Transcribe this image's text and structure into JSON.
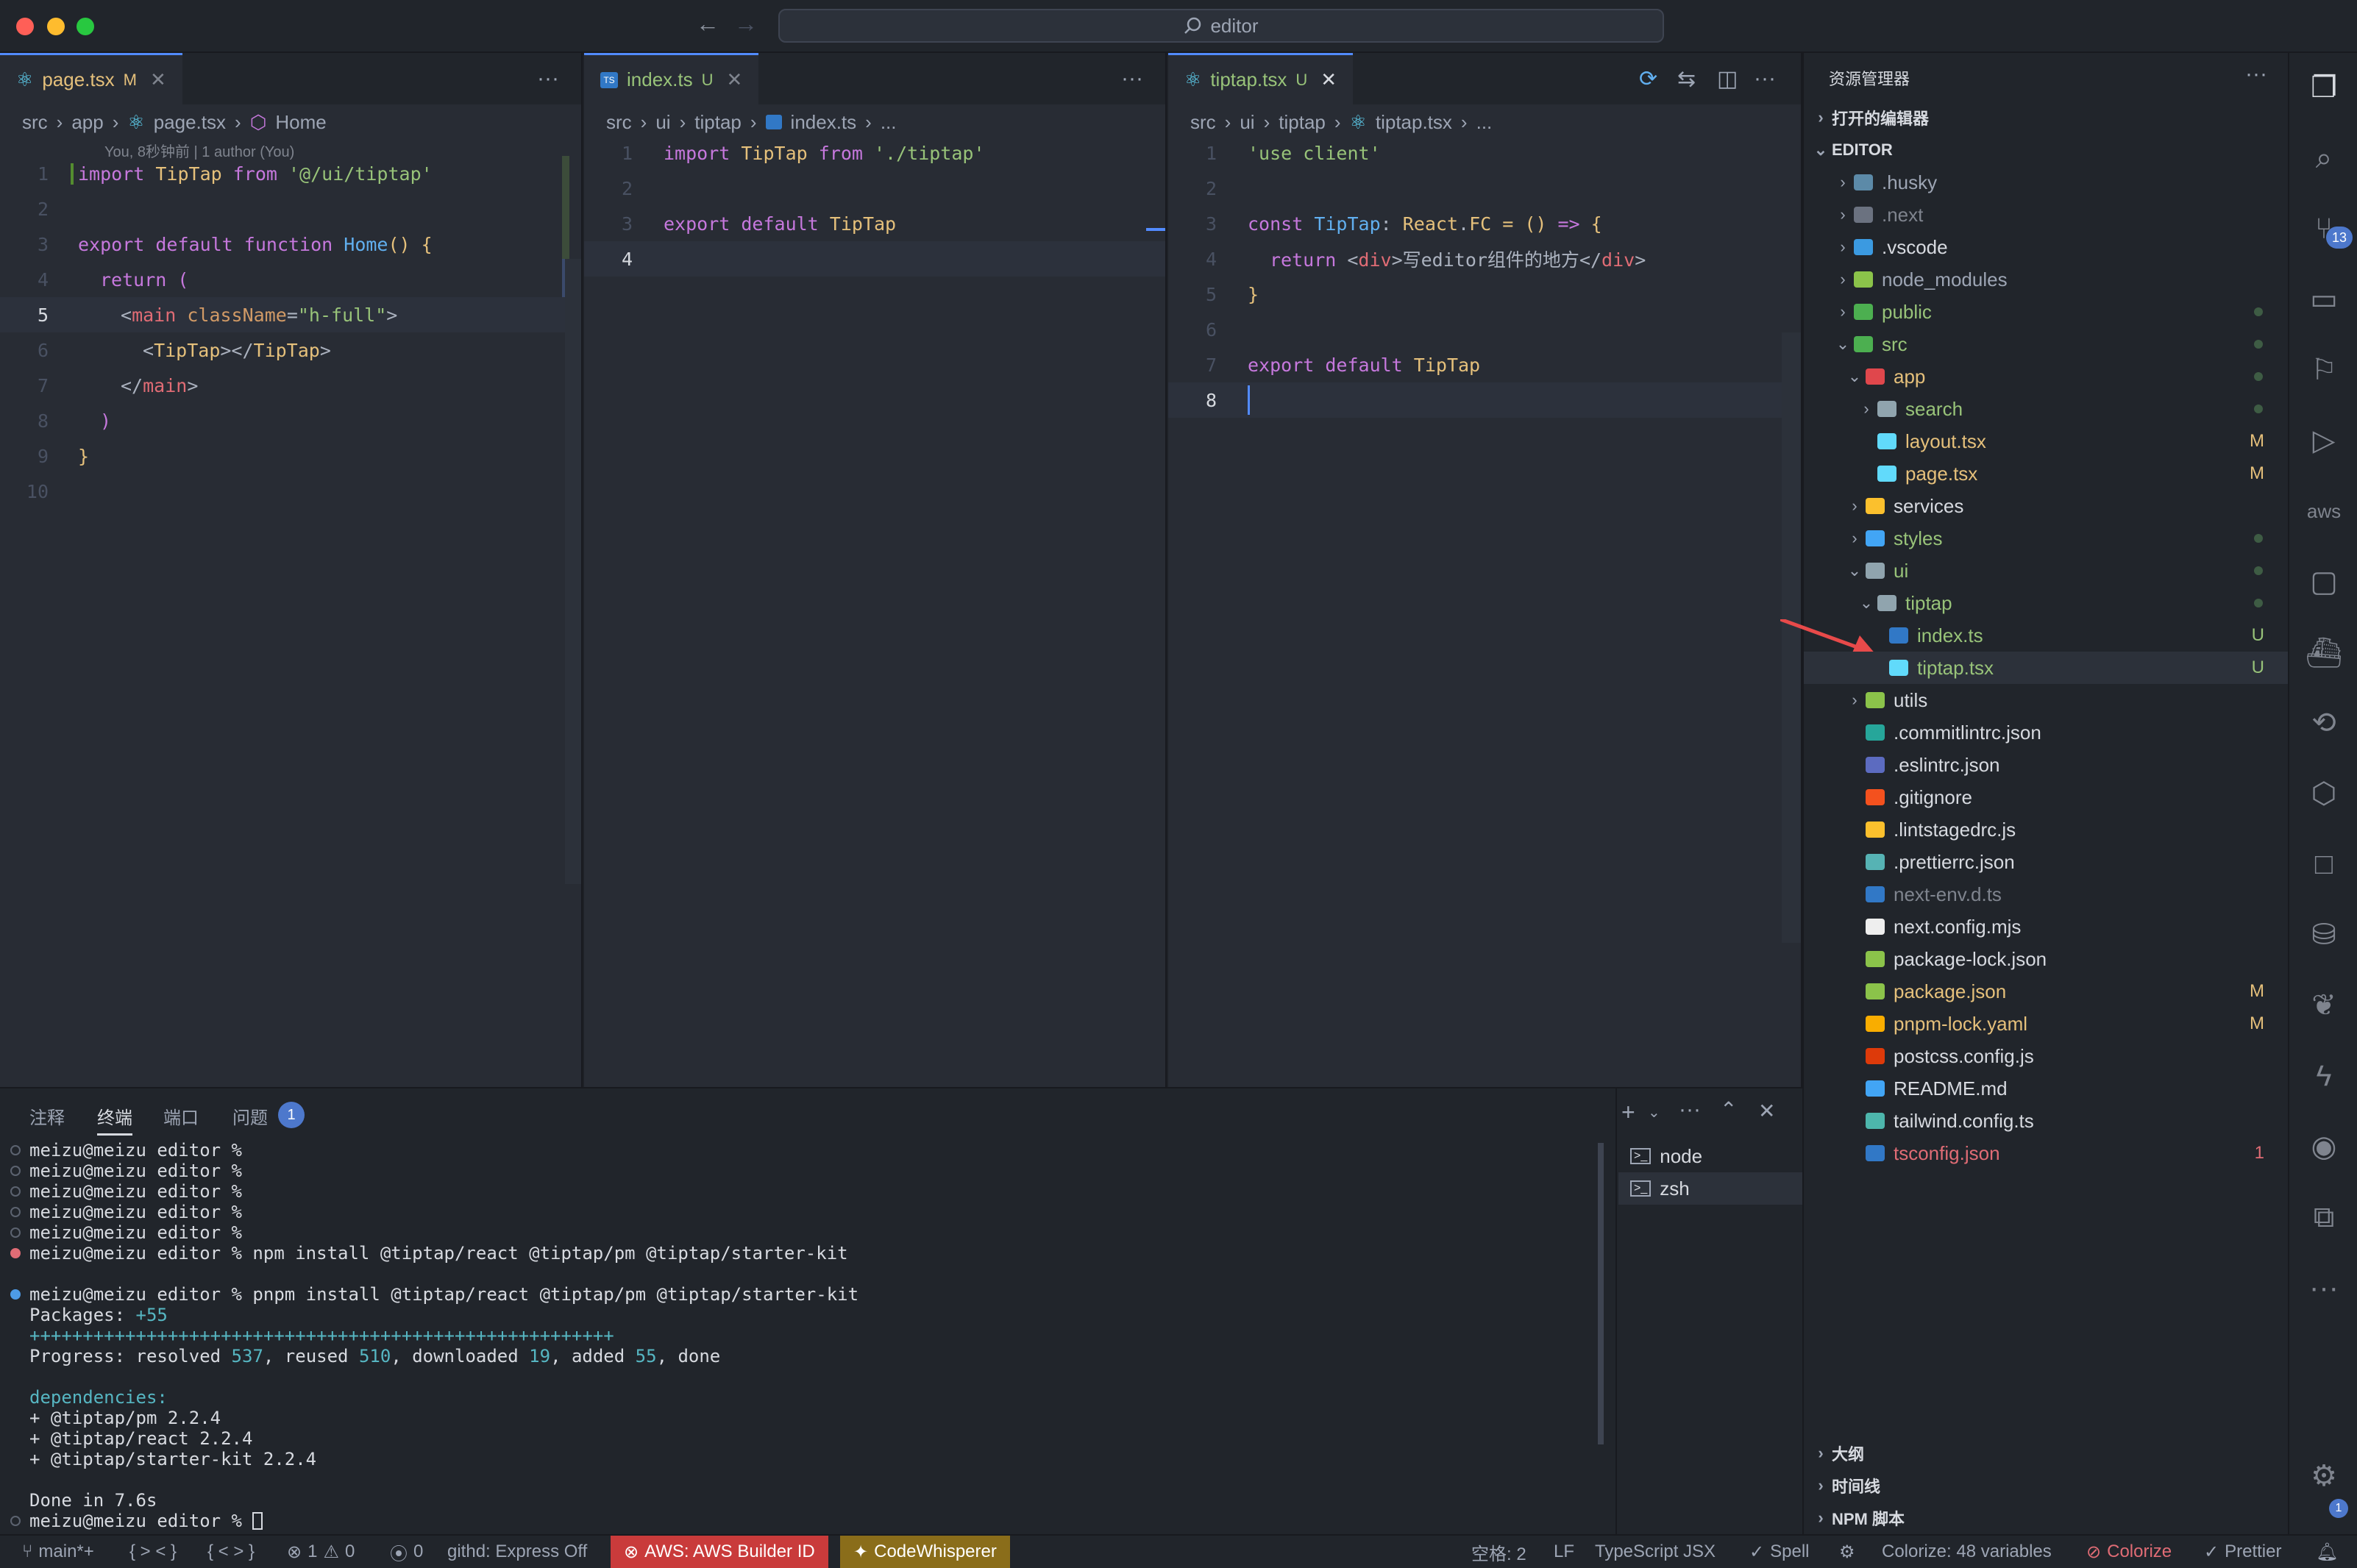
{
  "window": {
    "title": "editor"
  },
  "editor_groups": [
    {
      "tab": {
        "label": "page.tsx",
        "badge": "M"
      },
      "breadcrumb": [
        "src",
        "app",
        "page.tsx",
        "Home"
      ],
      "codelens": "You, 8秒钟前 | 1 author (You)",
      "line_numbers": [
        "1",
        "2",
        "3",
        "4",
        "5",
        "6",
        "7",
        "8",
        "9",
        "10"
      ],
      "current_line": "5"
    },
    {
      "tab": {
        "label": "index.ts",
        "badge": "U"
      },
      "breadcrumb": [
        "src",
        "ui",
        "tiptap",
        "index.ts",
        "..."
      ],
      "line_numbers": [
        "1",
        "2",
        "3",
        "4"
      ],
      "current_line": "4"
    },
    {
      "tab": {
        "label": "tiptap.tsx",
        "badge": "U"
      },
      "breadcrumb": [
        "src",
        "ui",
        "tiptap",
        "tiptap.tsx",
        "..."
      ],
      "line_numbers": [
        "1",
        "2",
        "3",
        "4",
        "5",
        "6",
        "7",
        "8"
      ],
      "current_line": "8"
    }
  ],
  "code": {
    "g1": {
      "l1": [
        "import",
        " TipTap ",
        "from",
        " '@/ui/tiptap'"
      ],
      "l3": [
        "export",
        " ",
        "default",
        " ",
        "function",
        " ",
        "Home",
        "() {"
      ],
      "l4": [
        "return",
        " ("
      ],
      "l5": [
        "<",
        "main",
        " ",
        "className",
        "=",
        "\"h-full\"",
        ">"
      ],
      "l6": [
        "<",
        "TipTap",
        "></",
        "TipTap",
        ">"
      ],
      "l7": [
        "</",
        "main",
        ">"
      ],
      "l8": [
        ")"
      ],
      "l9": [
        "}"
      ]
    },
    "g2": {
      "l1": [
        "import",
        " TipTap ",
        "from",
        " './tiptap'"
      ],
      "l3": [
        "export",
        " ",
        "default",
        " TipTap"
      ]
    },
    "g3": {
      "l1": [
        "'use client'"
      ],
      "l3": [
        "const",
        " ",
        "TipTap",
        ": ",
        "React",
        ".",
        "FC",
        " = () ",
        "=>",
        " {"
      ],
      "l4": [
        "return",
        " <",
        "div",
        ">写editor组件的地方</",
        "div",
        ">"
      ],
      "l5": [
        "}"
      ],
      "l7": [
        "export",
        " ",
        "default",
        " TipTap"
      ]
    }
  },
  "panel": {
    "tabs": [
      "注释",
      "终端",
      "端口",
      "问题"
    ],
    "problems_count": "1",
    "terminal_lines": [
      "meizu@meizu editor %",
      "meizu@meizu editor %",
      "meizu@meizu editor %",
      "meizu@meizu editor %",
      "meizu@meizu editor %",
      "meizu@meizu editor % npm install @tiptap/react @tiptap/pm @tiptap/starter-kit",
      "",
      "meizu@meizu editor % pnpm install @tiptap/react @tiptap/pm @tiptap/starter-kit",
      "Packages: +55",
      "+++++++++++++++++++++++++++++++++++++++++++++++++++++++",
      "Progress: resolved 537, reused 510, downloaded 19, added 55, done",
      "",
      "dependencies:",
      "+ @tiptap/pm 2.2.4",
      "+ @tiptap/react 2.2.4",
      "+ @tiptap/starter-kit 2.2.4",
      "",
      "Done in 7.6s",
      "meizu@meizu editor % "
    ],
    "terminals": [
      "node",
      "zsh"
    ]
  },
  "explorer": {
    "title": "资源管理器",
    "open_editors": "打开的编辑器",
    "root": "EDITOR",
    "items": [
      {
        "name": ".husky",
        "depth": 1,
        "chev": "›",
        "color": "#9da5b4",
        "icon": "#5c8aa8",
        "badge": ""
      },
      {
        "name": ".next",
        "depth": 1,
        "chev": "›",
        "color": "#7f848e",
        "icon": "#6b7280",
        "badge": ""
      },
      {
        "name": ".vscode",
        "depth": 1,
        "chev": "›",
        "color": "#d7dae0",
        "icon": "#3b9ae1",
        "badge": ""
      },
      {
        "name": "node_modules",
        "depth": 1,
        "chev": "›",
        "color": "#9da5b4",
        "icon": "#8bc34a",
        "badge": ""
      },
      {
        "name": "public",
        "depth": 1,
        "chev": "›",
        "color": "#98c379",
        "icon": "#4caf50",
        "badge": "dot"
      },
      {
        "name": "src",
        "depth": 1,
        "chev": "⌄",
        "color": "#98c379",
        "icon": "#4caf50",
        "badge": "dot"
      },
      {
        "name": "app",
        "depth": 2,
        "chev": "⌄",
        "color": "#e5c07b",
        "icon": "#e0474c",
        "badge": "dot"
      },
      {
        "name": "search",
        "depth": 3,
        "chev": "›",
        "color": "#98c379",
        "icon": "#90a4ae",
        "badge": "dot"
      },
      {
        "name": "layout.tsx",
        "depth": 3,
        "chev": "",
        "color": "#e5c07b",
        "icon": "#61dafb",
        "badge": "M"
      },
      {
        "name": "page.tsx",
        "depth": 3,
        "chev": "",
        "color": "#e5c07b",
        "icon": "#61dafb",
        "badge": "M"
      },
      {
        "name": "services",
        "depth": 2,
        "chev": "›",
        "color": "#d7dae0",
        "icon": "#fbc02d",
        "badge": ""
      },
      {
        "name": "styles",
        "depth": 2,
        "chev": "›",
        "color": "#98c379",
        "icon": "#42a5f5",
        "badge": "dot"
      },
      {
        "name": "ui",
        "depth": 2,
        "chev": "⌄",
        "color": "#98c379",
        "icon": "#90a4ae",
        "badge": "dot"
      },
      {
        "name": "tiptap",
        "depth": 3,
        "chev": "⌄",
        "color": "#98c379",
        "icon": "#90a4ae",
        "badge": "dot"
      },
      {
        "name": "index.ts",
        "depth": 4,
        "chev": "",
        "color": "#98c379",
        "icon": "#3178c6",
        "badge": "U"
      },
      {
        "name": "tiptap.tsx",
        "depth": 4,
        "chev": "",
        "color": "#98c379",
        "icon": "#61dafb",
        "badge": "U"
      },
      {
        "name": "utils",
        "depth": 2,
        "chev": "›",
        "color": "#d7dae0",
        "icon": "#8bc34a",
        "badge": ""
      },
      {
        "name": ".commitlintrc.json",
        "depth": 2,
        "chev": "",
        "color": "#d7dae0",
        "icon": "#26a69a",
        "badge": ""
      },
      {
        "name": ".eslintrc.json",
        "depth": 2,
        "chev": "",
        "color": "#d7dae0",
        "icon": "#5c6bc0",
        "badge": ""
      },
      {
        "name": ".gitignore",
        "depth": 2,
        "chev": "",
        "color": "#d7dae0",
        "icon": "#f4511e",
        "badge": ""
      },
      {
        "name": ".lintstagedrc.js",
        "depth": 2,
        "chev": "",
        "color": "#d7dae0",
        "icon": "#fbc02d",
        "badge": ""
      },
      {
        "name": ".prettierrc.json",
        "depth": 2,
        "chev": "",
        "color": "#d7dae0",
        "icon": "#56b3b4",
        "badge": ""
      },
      {
        "name": "next-env.d.ts",
        "depth": 2,
        "chev": "",
        "color": "#7f848e",
        "icon": "#3178c6",
        "badge": ""
      },
      {
        "name": "next.config.mjs",
        "depth": 2,
        "chev": "",
        "color": "#d7dae0",
        "icon": "#eeeeee",
        "badge": ""
      },
      {
        "name": "package-lock.json",
        "depth": 2,
        "chev": "",
        "color": "#d7dae0",
        "icon": "#8bc34a",
        "badge": ""
      },
      {
        "name": "package.json",
        "depth": 2,
        "chev": "",
        "color": "#e5c07b",
        "icon": "#8bc34a",
        "badge": "M"
      },
      {
        "name": "pnpm-lock.yaml",
        "depth": 2,
        "chev": "",
        "color": "#e5c07b",
        "icon": "#f9ad00",
        "badge": "M"
      },
      {
        "name": "postcss.config.js",
        "depth": 2,
        "chev": "",
        "color": "#d7dae0",
        "icon": "#dd3a0a",
        "badge": ""
      },
      {
        "name": "README.md",
        "depth": 2,
        "chev": "",
        "color": "#d7dae0",
        "icon": "#42a5f5",
        "badge": ""
      },
      {
        "name": "tailwind.config.ts",
        "depth": 2,
        "chev": "",
        "color": "#d7dae0",
        "icon": "#4db6ac",
        "badge": ""
      },
      {
        "name": "tsconfig.json",
        "depth": 2,
        "chev": "",
        "color": "#e06c75",
        "icon": "#3178c6",
        "badge": "1"
      }
    ],
    "sections": [
      "大纲",
      "时间线",
      "NPM 脚本"
    ]
  },
  "activity": {
    "scm_badge": "13",
    "settings_badge": "1",
    "aws_label": "aws"
  },
  "status": {
    "branch": "main*+",
    "braces1": "{ > < }",
    "braces2": "{ < > }",
    "errors": "1",
    "warnings": "0",
    "ports": "0",
    "githd": "githd: Express Off",
    "aws": "AWS: AWS Builder ID",
    "codewhisperer": "CodeWhisperer",
    "spaces": "空格: 2",
    "eol": "LF",
    "language": "TypeScript JSX",
    "spell": "Spell",
    "colorize_vars": "Colorize: 48 variables",
    "colorize": "Colorize",
    "prettier": "Prettier"
  }
}
